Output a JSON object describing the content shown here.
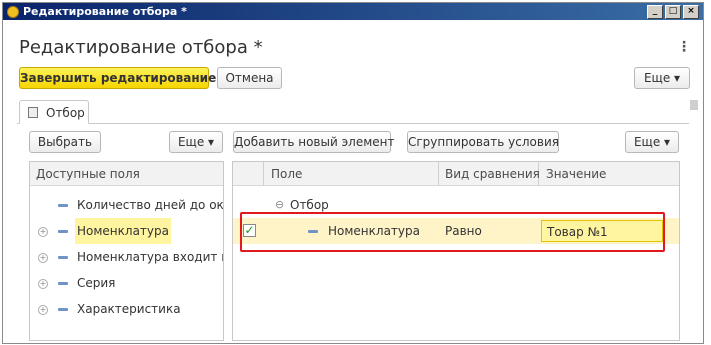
{
  "window": {
    "title": "Редактирование отбора *"
  },
  "form": {
    "title": "Редактирование отбора *",
    "finish_button": "Завершить редактирование",
    "cancel_button": "Отмена",
    "more_button": "Еще ▾"
  },
  "tab": {
    "label": "Отбор"
  },
  "left_panel": {
    "select_button": "Выбрать",
    "more_button": "Еще ▾",
    "header": "Доступные поля",
    "items": [
      {
        "label": "Количество дней до оконча",
        "expandable": false
      },
      {
        "label": "Номенклатура",
        "expandable": true,
        "highlighted": true
      },
      {
        "label": "Номенклатура входит в сег",
        "expandable": true
      },
      {
        "label": "Серия",
        "expandable": true
      },
      {
        "label": "Характеристика",
        "expandable": true
      }
    ]
  },
  "right_panel": {
    "add_button": "Добавить новый элемент",
    "group_button": "Сгруппировать условия",
    "more_button": "Еще ▾",
    "columns": {
      "field": "Поле",
      "comparison": "Вид сравнения",
      "value": "Значение"
    },
    "group_row": {
      "label": "Отбор"
    },
    "rows": [
      {
        "checked": true,
        "field": "Номенклатура",
        "comparison": "Равно",
        "value": "Товар №1"
      }
    ]
  },
  "colors": {
    "primary_button": "#f5d400",
    "highlight": "#fff4a0",
    "annotation": "#e0191f",
    "titlebar": "#0a246a"
  }
}
